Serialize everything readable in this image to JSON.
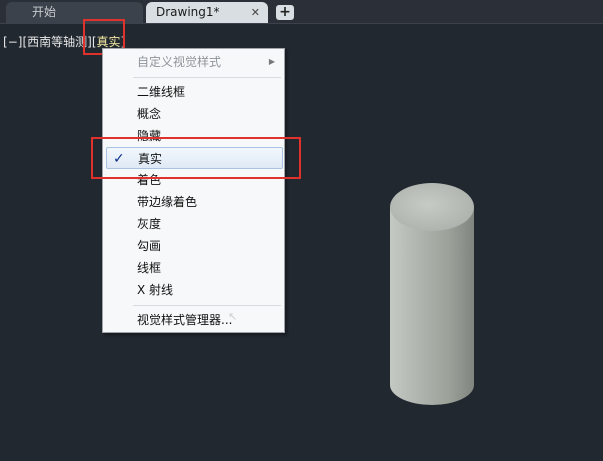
{
  "tabs": [
    {
      "label": "开始"
    },
    {
      "label": "Drawing1*",
      "close": "✕"
    }
  ],
  "new_tab_label": "+",
  "viewport_controls": {
    "bracket_open": "[",
    "minus": "−",
    "bracket_close": "]",
    "view": "西南等轴测",
    "visual_style": "真实"
  },
  "menu": {
    "items": [
      {
        "label": "自定义视觉样式",
        "disabled": true,
        "submenu_arrow": "▶"
      },
      {
        "label": "二维线框"
      },
      {
        "label": "概念"
      },
      {
        "label": "隐藏"
      },
      {
        "label": "真实",
        "checked": true,
        "check": "✓"
      },
      {
        "label": "着色"
      },
      {
        "label": "带边缘着色"
      },
      {
        "label": "灰度"
      },
      {
        "label": "勾画"
      },
      {
        "label": "线框"
      },
      {
        "label": "X 射线"
      },
      {
        "label": "视觉样式管理器..."
      }
    ]
  },
  "colors": {
    "background": "#212830",
    "highlight_box": "#e0312d",
    "cylinder": "#9fa49d"
  }
}
